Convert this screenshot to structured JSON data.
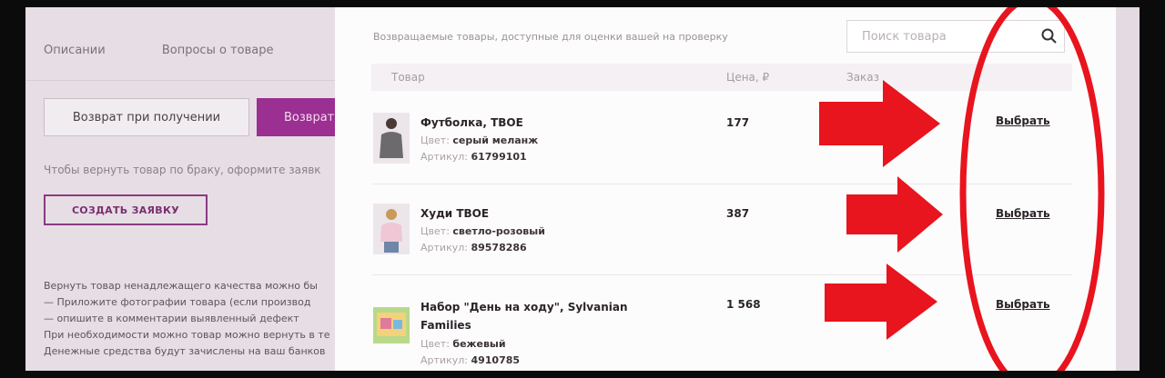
{
  "background_page": {
    "tabs": [
      "Описании",
      "Вопросы о товаре"
    ],
    "return_on_receipt_button": "Возврат при получении",
    "return_button": "Возврат",
    "hint": "Чтобы вернуть товар по браку, оформите заявк",
    "create_request_button": "СОЗДАТЬ ЗАЯВКУ",
    "text_lines": [
      "Вернуть товар ненадлежащего качества можно бы",
      "— Приложите фотографии товара (если производ",
      "— опишите в комментарии выявленный дефект",
      "При необходимости можно товар можно вернуть в те",
      "Денежные средства будут зачислены на ваш банков"
    ]
  },
  "modal": {
    "caption": "Возвращаемые товары, доступные для оценки вашей на проверку",
    "search_placeholder": "Поиск товара",
    "columns": {
      "product": "Товар",
      "price": "Цена, ₽",
      "status": "Заказ"
    },
    "choose_label": "Выбрать",
    "rows": [
      {
        "name": "Футболка, TBOE",
        "color_label": "Цвет:",
        "color": "серый меланж",
        "article_label": "Артикул:",
        "article": "61799101",
        "price": "177"
      },
      {
        "name": "Худи TBOE",
        "color_label": "Цвет:",
        "color": "светло-розовый",
        "article_label": "Артикул:",
        "article": "89578286",
        "price": "387"
      },
      {
        "name": "Набор \"День на ходу\", Sylvanian",
        "name_line2": "Families",
        "color_label": "Цвет:",
        "color": "бежевый",
        "article_label": "Артикул:",
        "article": "4910785",
        "price": "1 568"
      }
    ]
  },
  "annotations": {
    "arrow_color": "#e8141e",
    "ellipse_color": "#e8141e"
  }
}
